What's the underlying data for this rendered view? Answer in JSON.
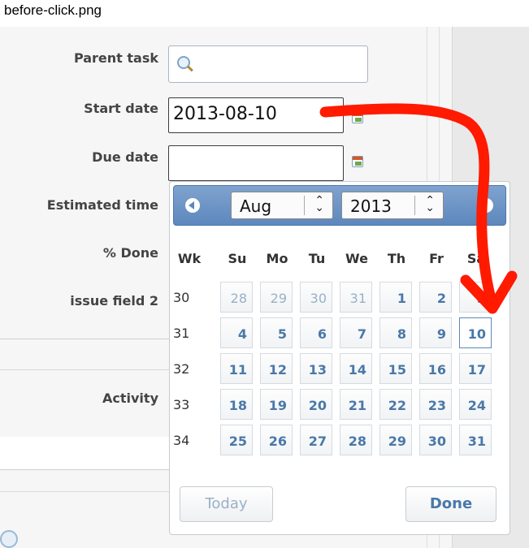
{
  "caption": "before-click.png",
  "form": {
    "parent_task_label": "Parent task",
    "parent_task_value": "",
    "start_date_label": "Start date",
    "start_date_value": "2013-08-10",
    "due_date_label": "Due date",
    "due_date_value": "",
    "estimated_time_label": "Estimated time",
    "done_label": "% Done",
    "issue_field_label": "issue field 2",
    "activity_label": "Activity"
  },
  "datepicker": {
    "month": "Aug",
    "year": "2013",
    "week_header": "Wk",
    "days": [
      "Su",
      "Mo",
      "Tu",
      "We",
      "Th",
      "Fr",
      "Sa"
    ],
    "weeks": [
      {
        "wk": "30",
        "dates": [
          "28",
          "29",
          "30",
          "31",
          "1",
          "2",
          "3"
        ]
      },
      {
        "wk": "31",
        "dates": [
          "4",
          "5",
          "6",
          "7",
          "8",
          "9",
          "10"
        ]
      },
      {
        "wk": "32",
        "dates": [
          "11",
          "12",
          "13",
          "14",
          "15",
          "16",
          "17"
        ]
      },
      {
        "wk": "33",
        "dates": [
          "18",
          "19",
          "20",
          "21",
          "22",
          "23",
          "24"
        ]
      },
      {
        "wk": "34",
        "dates": [
          "25",
          "26",
          "27",
          "28",
          "29",
          "30",
          "31"
        ]
      }
    ],
    "today_label": "Today",
    "done_label": "Done"
  },
  "colors": {
    "annotation_arrow": "#ff1a00",
    "header_blue": "#6b93c6"
  },
  "icons": {
    "search": "magnifier-icon",
    "calendar": "calendar-icon"
  }
}
